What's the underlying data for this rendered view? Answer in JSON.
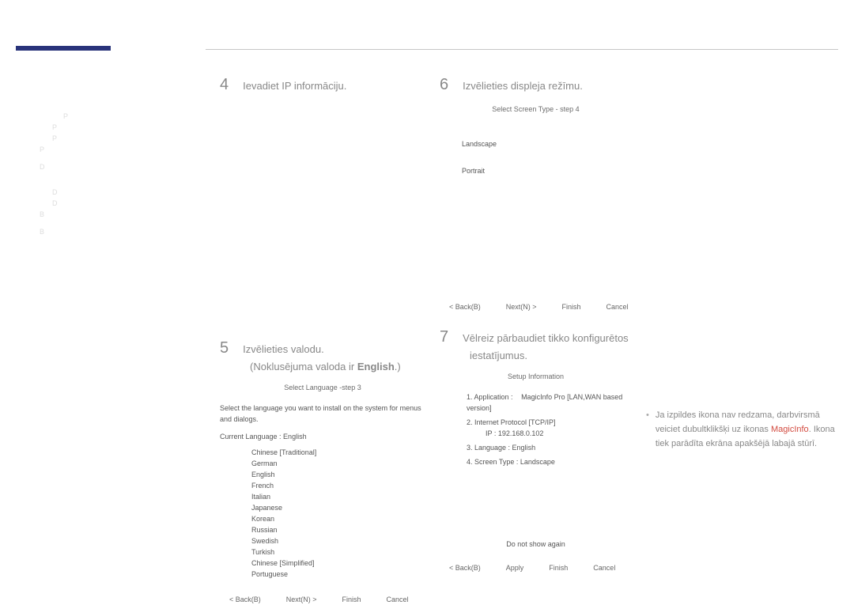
{
  "sidebar": {
    "items": [
      "P",
      "P",
      "P",
      "P",
      "",
      "D",
      "",
      "D",
      "D",
      "B",
      "",
      "B"
    ]
  },
  "step4": {
    "num": "4",
    "title": "Ievadiet IP informāciju."
  },
  "step5": {
    "num": "5",
    "title": "Izvēlieties valodu.",
    "sub": "(Noklusējuma valoda ir ",
    "sub_bold": "English",
    "sub_close": ".)",
    "panel_title": "Select Language -step 3",
    "hint": "Select the language you want to install on the system for menus and dialogs.",
    "current_label": "Current Language    :    English",
    "languages": [
      "Chinese [Traditional]",
      "German",
      "English",
      "French",
      "Italian",
      "Japanese",
      "Korean",
      "Russian",
      "Swedish",
      "Turkish",
      "Chinese [Simplified]",
      "Portuguese"
    ],
    "buttons": [
      "< Back(B)",
      "Next(N) >",
      "Finish",
      "Cancel"
    ]
  },
  "step6": {
    "num": "6",
    "title": "Izvēlieties displeja režīmu.",
    "panel_title": "Select Screen Type - step 4",
    "opt1": "Landscape",
    "opt2": "Portrait",
    "buttons": [
      "< Back(B)",
      "Next(N) >",
      "Finish",
      "Cancel"
    ]
  },
  "step7": {
    "num": "7",
    "title1": "Vēlreiz pārbaudiet tikko konfigurētos",
    "title2": "iestatījumus.",
    "note1": "Ja izpildes ikona nav redzama, darbvirsmā veiciet dubultklikšķi uz ikonas ",
    "magic": "MagicInfo",
    "note1_end": ".",
    "note2": "Ikona tiek parādīta ekrāna apakšējā labajā stūrī.",
    "setup": {
      "title": "Setup Information",
      "app_label": "1. Application :",
      "app_value": "MagicInfo Pro [LAN,WAN based version]",
      "ip_label": "2. Internet Protocol [TCP/IP]",
      "ip_row": "IP :      192.168.0.102",
      "lang_label": "3. Language :      English",
      "scr_label": "4. Screen Type :    Landscape",
      "dns": "Do not show again",
      "buttons": [
        "< Back(B)",
        "Apply",
        "Finish",
        "Cancel"
      ]
    }
  }
}
